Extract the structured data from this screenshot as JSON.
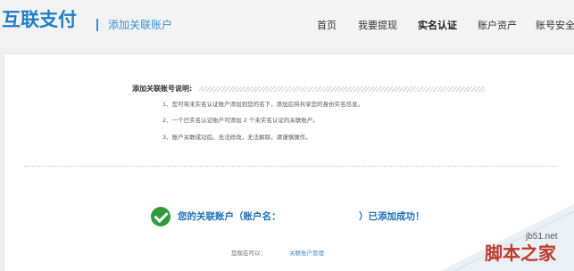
{
  "header": {
    "logo_text": "互联支付",
    "page_name": "添加关联账户",
    "nav": [
      {
        "label": "首页",
        "active": false
      },
      {
        "label": "我要提现",
        "active": false
      },
      {
        "label": "实名认证",
        "active": true
      },
      {
        "label": "账户资产",
        "active": false
      },
      {
        "label": "账号安全",
        "active": false
      }
    ]
  },
  "instructions": {
    "title": "添加关联账号说明:",
    "items": [
      "1、您可将未实名认证账户添加到您的名下，添加后将共享您的身份实名信息。",
      "2、一个已实名认证账户可添加 2 个未实名认证的关联账户。",
      "3、账户关联成功后，无法修改，无法解除，请谨慎操作。"
    ]
  },
  "result": {
    "message_prefix": "您的关联账户（账户名：",
    "message_suffix": "）已添加成功！",
    "next_label": "您现在可以：",
    "next_link": "关联账户管理"
  },
  "watermark": {
    "site": "jb51.net",
    "name": "脚本之家"
  },
  "colors": {
    "brand_blue": "#1f7fc4",
    "success_green": "#2f9a3c",
    "watermark_red": "#c0392b"
  }
}
